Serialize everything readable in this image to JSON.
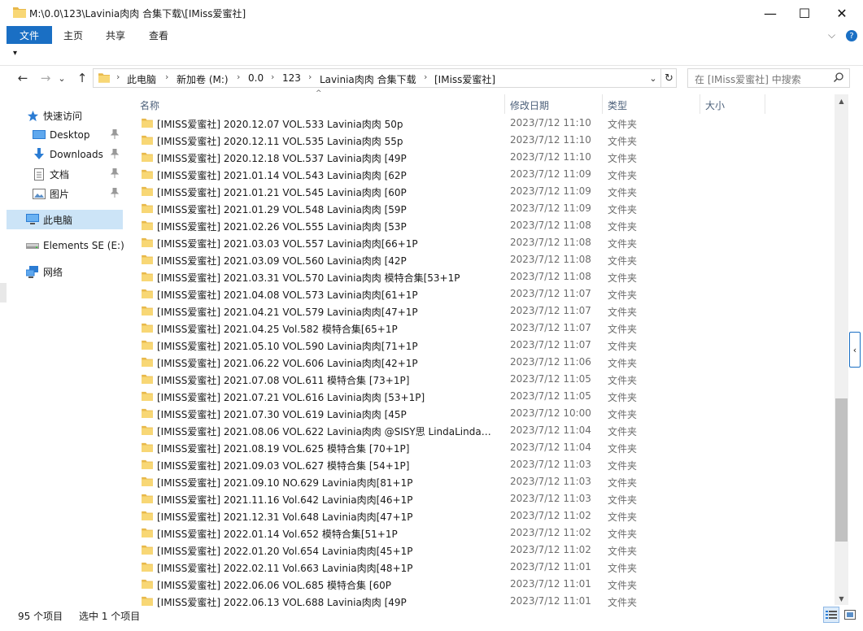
{
  "window": {
    "title": "M:\\0.0\\123\\Lavinia肉肉 合集下载\\[IMiss爱蜜社]",
    "minimize": "—",
    "maximize": "☐",
    "close": "✕"
  },
  "ribbon": {
    "tabs": [
      "文件",
      "主页",
      "共享",
      "查看"
    ],
    "expand": "⌵",
    "help": "?"
  },
  "quick_access": {
    "customize": "▾"
  },
  "nav_buttons": {
    "back": "←",
    "forward": "→",
    "recent": "⌄",
    "up": "↑"
  },
  "address": {
    "crumbs": [
      "此电脑",
      "新加卷 (M:)",
      "0.0",
      "123",
      "Lavinia肉肉 合集下载",
      "[IMiss爱蜜社]"
    ],
    "separator": "›",
    "dropdown": "⌄",
    "refresh": "↻"
  },
  "search": {
    "placeholder": "在 [IMiss爱蜜社] 中搜索",
    "icon": "search-icon"
  },
  "nav_pane": [
    {
      "label": "快速访问",
      "icon": "star-icon",
      "pinned": false
    },
    {
      "label": "Desktop",
      "icon": "desktop-icon",
      "pinned": true
    },
    {
      "label": "Downloads",
      "icon": "download-icon",
      "pinned": true
    },
    {
      "label": "文档",
      "icon": "document-icon",
      "pinned": true
    },
    {
      "label": "图片",
      "icon": "picture-icon",
      "pinned": true
    },
    {
      "label": "此电脑",
      "icon": "computer-icon",
      "pinned": false,
      "selected": true
    },
    {
      "label": "Elements SE (E:)",
      "icon": "drive-icon",
      "pinned": false
    },
    {
      "label": "网络",
      "icon": "network-icon",
      "pinned": false
    }
  ],
  "pin_glyph": "📌",
  "columns": {
    "name": "名称",
    "date": "修改日期",
    "type": "类型",
    "size": "大小",
    "sort_indicator": "^"
  },
  "files": [
    {
      "name": "[IMISS爱蜜社] 2020.12.07 VOL.533 Lavinia肉肉 50p",
      "date": "2023/7/12 11:10",
      "type": "文件夹"
    },
    {
      "name": "[IMISS爱蜜社] 2020.12.11 VOL.535 Lavinia肉肉 55p",
      "date": "2023/7/12 11:10",
      "type": "文件夹"
    },
    {
      "name": "[IMISS爱蜜社] 2020.12.18 VOL.537 Lavinia肉肉 [49P",
      "date": "2023/7/12 11:10",
      "type": "文件夹"
    },
    {
      "name": "[IMISS爱蜜社] 2021.01.14 VOL.543 Lavinia肉肉 [62P",
      "date": "2023/7/12 11:09",
      "type": "文件夹"
    },
    {
      "name": "[IMISS爱蜜社] 2021.01.21 VOL.545 Lavinia肉肉 [60P",
      "date": "2023/7/12 11:09",
      "type": "文件夹"
    },
    {
      "name": "[IMISS爱蜜社] 2021.01.29 VOL.548 Lavinia肉肉 [59P",
      "date": "2023/7/12 11:09",
      "type": "文件夹"
    },
    {
      "name": "[IMISS爱蜜社] 2021.02.26 VOL.555 Lavinia肉肉 [53P",
      "date": "2023/7/12 11:08",
      "type": "文件夹"
    },
    {
      "name": "[IMISS爱蜜社] 2021.03.03 VOL.557 Lavinia肉肉[66+1P",
      "date": "2023/7/12 11:08",
      "type": "文件夹"
    },
    {
      "name": "[IMISS爱蜜社] 2021.03.09 VOL.560 Lavinia肉肉 [42P",
      "date": "2023/7/12 11:08",
      "type": "文件夹"
    },
    {
      "name": "[IMISS爱蜜社] 2021.03.31 VOL.570 Lavinia肉肉 模特合集[53+1P",
      "date": "2023/7/12 11:08",
      "type": "文件夹"
    },
    {
      "name": "[IMISS爱蜜社] 2021.04.08 VOL.573 Lavinia肉肉[61+1P",
      "date": "2023/7/12 11:07",
      "type": "文件夹"
    },
    {
      "name": "[IMISS爱蜜社] 2021.04.21 VOL.579 Lavinia肉肉[47+1P",
      "date": "2023/7/12 11:07",
      "type": "文件夹"
    },
    {
      "name": "[IMISS爱蜜社] 2021.04.25 Vol.582 模特合集[65+1P",
      "date": "2023/7/12 11:07",
      "type": "文件夹"
    },
    {
      "name": "[IMISS爱蜜社] 2021.05.10 VOL.590 Lavinia肉肉[71+1P",
      "date": "2023/7/12 11:07",
      "type": "文件夹"
    },
    {
      "name": "[IMISS爱蜜社] 2021.06.22 VOL.606 Lavinia肉肉[42+1P",
      "date": "2023/7/12 11:06",
      "type": "文件夹"
    },
    {
      "name": "[IMISS爱蜜社] 2021.07.08 VOL.611 模特合集 [73+1P]",
      "date": "2023/7/12 11:05",
      "type": "文件夹"
    },
    {
      "name": "[IMISS爱蜜社] 2021.07.21 VOL.616 Lavinia肉肉 [53+1P]",
      "date": "2023/7/12 11:05",
      "type": "文件夹"
    },
    {
      "name": "[IMISS爱蜜社] 2021.07.30 VOL.619 Lavinia肉肉 [45P",
      "date": "2023/7/12 10:00",
      "type": "文件夹"
    },
    {
      "name": "[IMISS爱蜜社] 2021.08.06 VOL.622 Lavinia肉肉 @SISY思 LindaLinda合集 ...",
      "date": "2023/7/12 11:04",
      "type": "文件夹"
    },
    {
      "name": "[IMISS爱蜜社] 2021.08.19 VOL.625 模特合集 [70+1P]",
      "date": "2023/7/12 11:04",
      "type": "文件夹"
    },
    {
      "name": "[IMISS爱蜜社] 2021.09.03 VOL.627 模特合集 [54+1P]",
      "date": "2023/7/12 11:03",
      "type": "文件夹"
    },
    {
      "name": "[IMISS爱蜜社] 2021.09.10 NO.629 Lavinia肉肉[81+1P",
      "date": "2023/7/12 11:03",
      "type": "文件夹"
    },
    {
      "name": "[IMISS爱蜜社] 2021.11.16 Vol.642 Lavinia肉肉[46+1P",
      "date": "2023/7/12 11:03",
      "type": "文件夹"
    },
    {
      "name": "[IMISS爱蜜社] 2021.12.31 Vol.648 Lavinia肉肉[47+1P",
      "date": "2023/7/12 11:02",
      "type": "文件夹"
    },
    {
      "name": "[IMISS爱蜜社] 2022.01.14 Vol.652 模特合集[51+1P",
      "date": "2023/7/12 11:02",
      "type": "文件夹"
    },
    {
      "name": "[IMISS爱蜜社] 2022.01.20 Vol.654 Lavinia肉肉[45+1P",
      "date": "2023/7/12 11:02",
      "type": "文件夹"
    },
    {
      "name": "[IMISS爱蜜社] 2022.02.11 Vol.663 Lavinia肉肉[48+1P",
      "date": "2023/7/12 11:01",
      "type": "文件夹"
    },
    {
      "name": "[IMISS爱蜜社] 2022.06.06 VOL.685 模特合集 [60P",
      "date": "2023/7/12 11:01",
      "type": "文件夹"
    },
    {
      "name": "[IMISS爱蜜社] 2022.06.13 VOL.688 Lavinia肉肉 [49P",
      "date": "2023/7/12 11:01",
      "type": "文件夹"
    }
  ],
  "scrollbar": {
    "up": "▲",
    "down": "▼",
    "position_fraction": 0.68
  },
  "preview_toggle": "‹",
  "status": {
    "item_count": "95 个项目",
    "selected": "选中 1 个项目"
  },
  "colors": {
    "accent": "#1a6fc4",
    "folder": "#f8d775",
    "selected_bg": "#cce4f7"
  }
}
